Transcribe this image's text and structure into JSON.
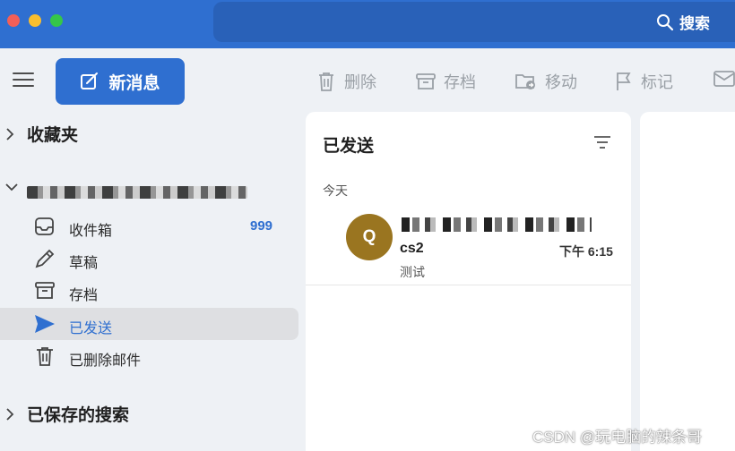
{
  "titlebar": {
    "search_label": "搜索",
    "accent": "#2f6fd0"
  },
  "toolbar": {
    "new_message_label": "新消息",
    "delete_label": "删除",
    "archive_label": "存档",
    "move_label": "移动",
    "flag_label": "标记"
  },
  "sidebar": {
    "favorites_label": "收藏夹",
    "account_label": "",
    "folders": [
      {
        "label": "收件箱",
        "icon": "inbox-icon",
        "count": "999"
      },
      {
        "label": "草稿",
        "icon": "pencil-icon",
        "count": ""
      },
      {
        "label": "存档",
        "icon": "archive-icon",
        "count": ""
      },
      {
        "label": "已发送",
        "icon": "send-icon",
        "count": "",
        "active": true
      },
      {
        "label": "已删除邮件",
        "icon": "trash-icon",
        "count": ""
      }
    ],
    "saved_searches_label": "已保存的搜索"
  },
  "message_list": {
    "title": "已发送",
    "group_label": "今天",
    "messages": [
      {
        "avatar_letter": "Q",
        "avatar_color": "#9a7520",
        "subject": "cs2",
        "time": "下午 6:15",
        "preview": "测试"
      }
    ]
  },
  "watermark": "CSDN @玩电脑的辣条哥"
}
